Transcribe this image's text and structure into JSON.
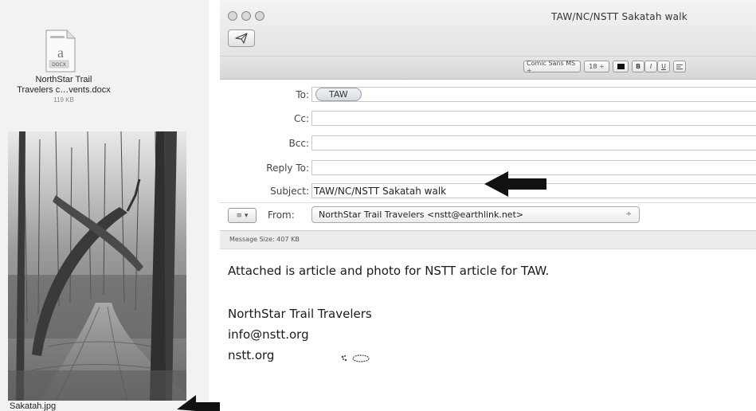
{
  "desktop": {
    "attachment_doc": {
      "name_line1": "NorthStar Trail",
      "name_line2": "Travelers c…vents.docx",
      "size": "119 KB",
      "badge": "DOCX"
    },
    "attachment_photo": {
      "name": "Sakatah.jpg"
    }
  },
  "window": {
    "title": "TAW/NC/NSTT Sakatah walk",
    "toolbar": {
      "send_icon": "paper-plane-icon"
    },
    "format_bar": {
      "font": "Comic Sans MS ÷",
      "size": "18 ÷",
      "bold": "B",
      "italic": "I",
      "underline": "U"
    },
    "headers": {
      "to_label": "To:",
      "to_recipient": "TAW",
      "cc_label": "Cc:",
      "bcc_label": "Bcc:",
      "replyto_label": "Reply To:",
      "subject_label": "Subject:",
      "subject_value": "TAW/NC/NSTT Sakatah walk",
      "from_menu": "≡ ▾",
      "from_label": "From:",
      "from_value": "NorthStar Trail Travelers <nstt@earthlink.net>",
      "from_chevron": "÷"
    },
    "message_size": "Message Size:  407 KB",
    "body": {
      "line1": "Attached  is article and photo for NSTT article for TAW.",
      "line2": "NorthStar Trail Travelers",
      "line3": "info@nstt.org",
      "line4": "nstt.org"
    }
  }
}
